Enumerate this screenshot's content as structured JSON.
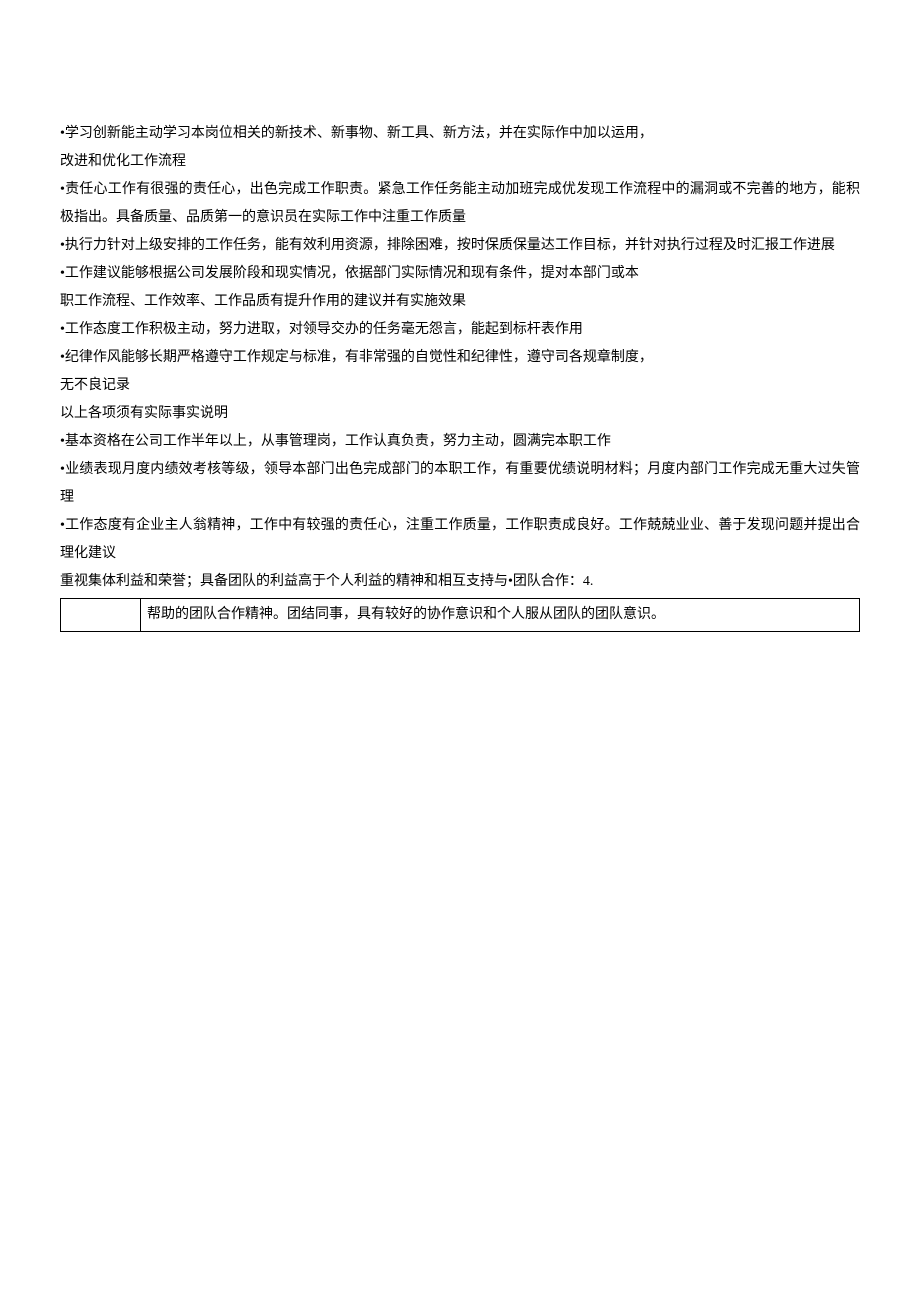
{
  "paragraphs": [
    "•学习创新能主动学习本岗位相关的新技术、新事物、新工具、新方法，并在实际作中加以运用，",
    "改进和优化工作流程",
    "•责任心工作有很强的责任心，出色完成工作职责。紧急工作任务能主动加班完成优发现工作流程中的漏洞或不完善的地方，能积极指出。具备质量、品质第一的意识员在实际工作中注重工作质量",
    "•执行力针对上级安排的工作任务，能有效利用资源，排除困难，按时保质保量达工作目标，并针对执行过程及时汇报工作进展",
    "•工作建议能够根据公司发展阶段和现实情况，依据部门实际情况和现有条件，提对本部门或本",
    "职工作流程、工作效率、工作品质有提升作用的建议并有实施效果",
    "•工作态度工作积极主动，努力进取，对领导交办的任务毫无怨言，能起到标杆表作用",
    "•纪律作风能够长期严格遵守工作规定与标准，有非常强的自觉性和纪律性，遵守司各规章制度，",
    "无不良记录",
    "以上各项须有实际事实说明",
    "•基本资格在公司工作半年以上，从事管理岗，工作认真负责，努力主动，圆满完本职工作",
    "•业绩表现月度内绩效考核等级，领导本部门出色完成部门的本职工作，有重要优绩说明材料；月度内部门工作完成无重大过失管理",
    "•工作态度有企业主人翁精神，工作中有较强的责任心，注重工作质量，工作职责成良好。工作兢兢业业、善于发现问题并提出合理化建议",
    "重视集体利益和荣誉；具备团队的利益高于个人利益的精神和相互支持与•团队合作：4."
  ],
  "table": {
    "left": "",
    "right": "帮助的团队合作精神。团结同事，具有较好的协作意识和个人服从团队的团队意识。"
  }
}
